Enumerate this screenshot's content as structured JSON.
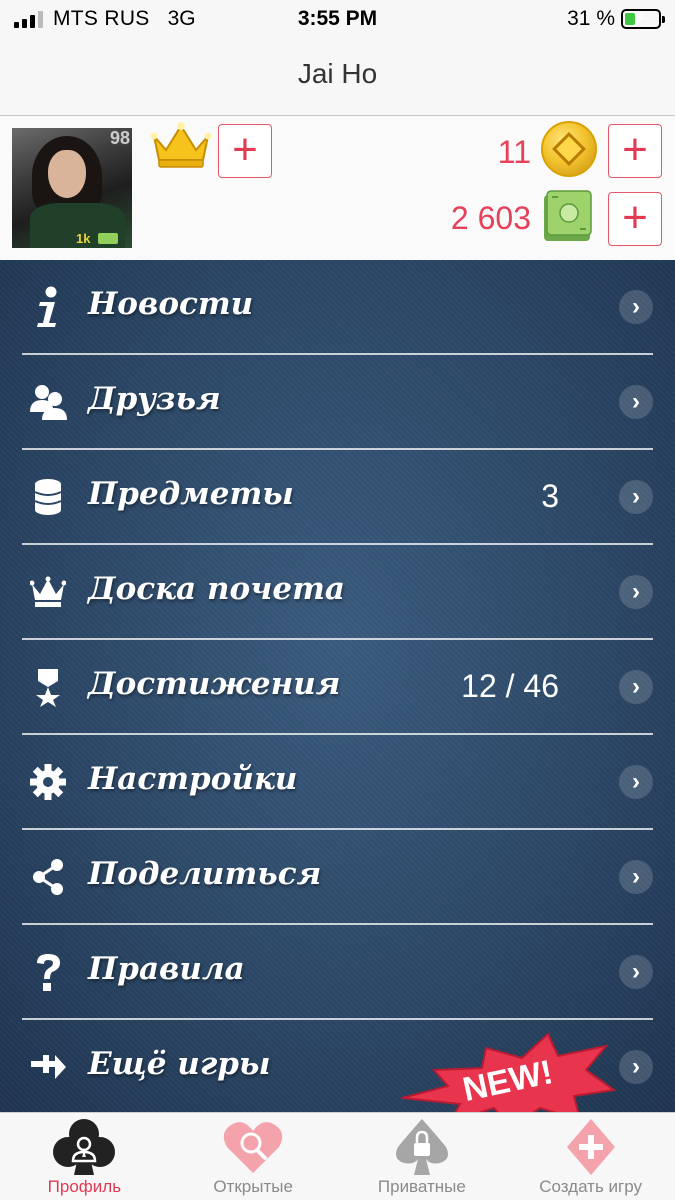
{
  "status_bar": {
    "carrier": "MTS RUS",
    "network": "3G",
    "time": "3:55 PM",
    "battery_percent": "31 %",
    "battery_level": 0.31
  },
  "nav": {
    "title": "Jai Ho"
  },
  "profile": {
    "avatar_level": "98",
    "avatar_badge": "1k",
    "coins": "11",
    "cash": "2 603"
  },
  "menu": {
    "items": [
      {
        "label": "Новости",
        "icon": "info-icon",
        "value": ""
      },
      {
        "label": "Друзья",
        "icon": "friends-icon",
        "value": ""
      },
      {
        "label": "Предметы",
        "icon": "coins-stack-icon",
        "value": "3"
      },
      {
        "label": "Доска почета",
        "icon": "crown-icon",
        "value": ""
      },
      {
        "label": "Достижения",
        "icon": "award-ribbon-icon",
        "value": "12 / 46"
      },
      {
        "label": "Настройки",
        "icon": "gear-icon",
        "value": ""
      },
      {
        "label": "Поделиться",
        "icon": "share-icon",
        "value": ""
      },
      {
        "label": "Правила",
        "icon": "question-icon",
        "value": ""
      },
      {
        "label": "Ещё игры",
        "icon": "more-games-icon",
        "value": ""
      }
    ],
    "new_badge": "NEW!"
  },
  "tabs": [
    {
      "label": "Профиль",
      "icon": "club-profile-icon",
      "active": true
    },
    {
      "label": "Открытые",
      "icon": "heart-search-icon",
      "active": false
    },
    {
      "label": "Приватные",
      "icon": "spade-lock-icon",
      "active": false
    },
    {
      "label": "Создать игру",
      "icon": "diamond-plus-icon",
      "active": false
    }
  ],
  "colors": {
    "accent": "#e23a52",
    "menu_bg": "#2b4766",
    "tab_inactive": "#8a8a8a"
  }
}
